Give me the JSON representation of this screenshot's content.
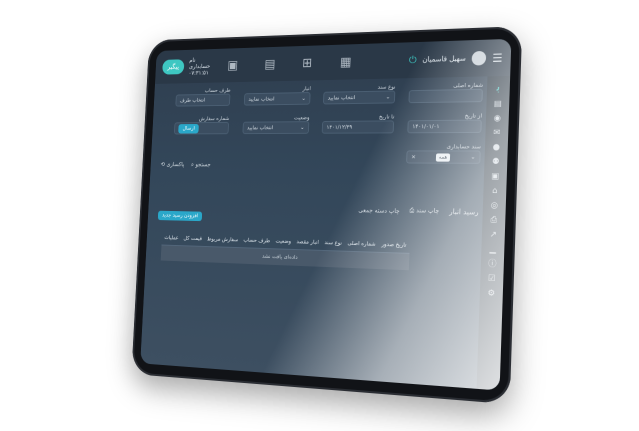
{
  "topbar": {
    "logo": "پیگیر",
    "company_line1": "نام",
    "company_line2": "حسابداری",
    "time": "۰۷:۳۱:۵۱",
    "user_name": "سهیل قاسمیان",
    "icons": [
      "building-icon",
      "document-icon",
      "cart-icon",
      "cash-register-icon",
      "power-icon",
      "user-avatar-icon",
      "hamburger-menu-icon"
    ]
  },
  "sidebar": {
    "icons": [
      "brand-icon",
      "book-icon",
      "user-circle-icon",
      "envelope-icon",
      "person-icon",
      "group-icon",
      "calendar-icon",
      "bank-icon",
      "coins-icon",
      "printer-icon",
      "chart-up-icon",
      "chart-icon",
      "info-icon",
      "calendar-check-icon",
      "gear-icon"
    ]
  },
  "form": {
    "doc_number_label": "شماره اصلی",
    "doc_number_value": "",
    "doc_type_label": "نوع سند",
    "doc_type_value": "انتخاب نمایید",
    "warehouse_label": "انبار",
    "warehouse_value": "انتخاب نمایید",
    "account_side_label": "طرف حساب",
    "account_side_value": "انتخاب طرف",
    "from_date_label": "از تاریخ",
    "from_date_value": "۱۴۰۱/۰۱/۰۱",
    "to_date_label": "تا تاریخ",
    "to_date_value": "۱۴۰۱/۱۲/۲۹",
    "status_label": "وضعیت",
    "status_value": "انتخاب نمایید",
    "order_number_label": "شماره سفارش",
    "order_number_value": "ارسال",
    "accounting_doc_label": "سند حسابداری",
    "accounting_chip": "همه",
    "search_button": "جستجو",
    "clear_button": "پاکسازی"
  },
  "toolbar": {
    "receipt_label": "رسید انبار",
    "print_doc": "چاپ سند",
    "print_range": "چاپ دسته جمعی",
    "new_receipt": "افزودن رسید جدید"
  },
  "table": {
    "columns": [
      "تاریخ صدور",
      "شماره اصلی",
      "نوع سند",
      "انبار مقصد",
      "وضعیت",
      "طرف حساب",
      "سفارش مربوط",
      "قیمت کل",
      "عملیات"
    ],
    "empty_message": "داده‌ای یافت نشد"
  }
}
